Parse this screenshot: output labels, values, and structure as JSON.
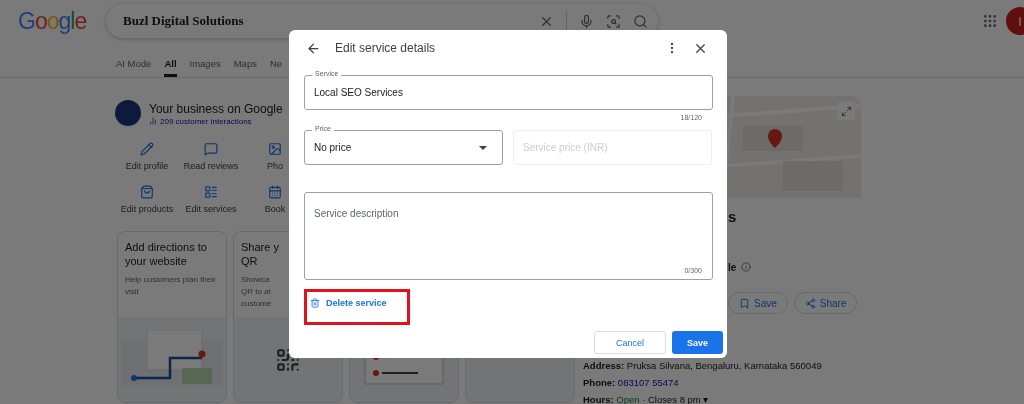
{
  "search": {
    "logo": "Google",
    "query": "Buzl Digital Solutions"
  },
  "avatar": {
    "initial": "I"
  },
  "tabs": [
    {
      "label": "AI Mode",
      "selected": false
    },
    {
      "label": "All",
      "selected": true
    },
    {
      "label": "Images",
      "selected": false
    },
    {
      "label": "Maps",
      "selected": false
    },
    {
      "label": "Ne",
      "selected": false
    }
  ],
  "business": {
    "title": "Your business on Google",
    "interactions": "209 customer interactions",
    "actions": [
      {
        "label": "Edit profile"
      },
      {
        "label": "Read reviews"
      },
      {
        "label": "Pho"
      },
      {
        "label": "Edit products"
      },
      {
        "label": "Edit services"
      },
      {
        "label": "Book"
      }
    ],
    "cards": [
      {
        "kind": "directions",
        "title_lines": [
          "Add directions to",
          "your website"
        ],
        "description_lines": [
          "Help customers plan their",
          "visit"
        ]
      },
      {
        "kind": "qr",
        "title_lines": [
          "Share y",
          "QR"
        ],
        "description_lines": [
          "Showca",
          "QR to at",
          "custome"
        ]
      },
      {
        "kind": "list"
      },
      {
        "kind": "blank"
      }
    ]
  },
  "place": {
    "kind": "picture",
    "fragments": [
      "s",
      "le"
    ],
    "buttons": [
      "Save",
      "Share"
    ],
    "address": {
      "label": "Address:",
      "value": "Pruksa Silvana, Bengaluru, Karnataka 560049"
    },
    "phone": {
      "label": "Phone:",
      "value": "083107 55474"
    },
    "hours": {
      "label": "Hours:",
      "status": "Open",
      "rest": "· Closes 8 pm ▾"
    }
  },
  "dialog": {
    "title": "Edit service details",
    "service": {
      "label": "Service",
      "value": "Local SEO Services",
      "counter": "18/120"
    },
    "price": {
      "label": "Price",
      "value": "No price"
    },
    "price_amount": {
      "placeholder": "Service price (INR)",
      "disabled": true
    },
    "description": {
      "placeholder": "Service description",
      "counter": "0/300"
    },
    "delete": {
      "label": "Delete service",
      "highlighted": true
    },
    "buttons": {
      "cancel": "Cancel",
      "save": "Save"
    }
  }
}
